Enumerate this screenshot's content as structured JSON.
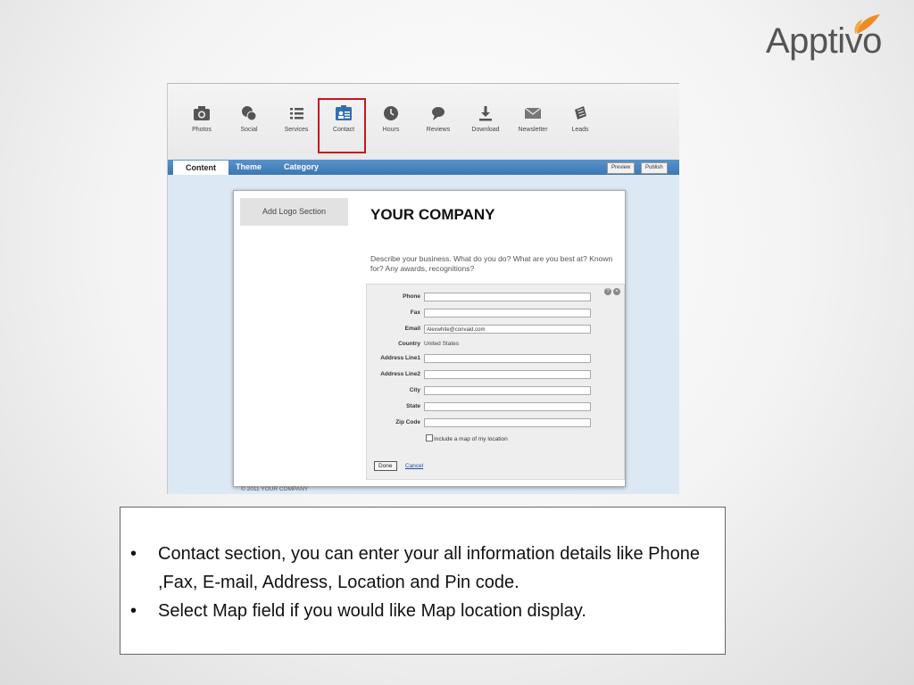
{
  "brand": {
    "name": "Apptivo"
  },
  "toolbar": {
    "items": [
      {
        "label": "Photos",
        "icon": "camera-icon"
      },
      {
        "label": "Social",
        "icon": "social-icon"
      },
      {
        "label": "Services",
        "icon": "list-icon"
      },
      {
        "label": "Contact",
        "icon": "contact-card-icon",
        "selected": true
      },
      {
        "label": "Hours",
        "icon": "clock-icon"
      },
      {
        "label": "Reviews",
        "icon": "speech-bubble-icon"
      },
      {
        "label": "Download",
        "icon": "download-icon"
      },
      {
        "label": "Newsletter",
        "icon": "envelope-icon"
      },
      {
        "label": "Leads",
        "icon": "leads-icon"
      }
    ]
  },
  "tabs": {
    "content": "Content",
    "theme": "Theme",
    "category": "Category",
    "preview": "Preview",
    "publish": "Publish"
  },
  "page": {
    "logo_section": "Add Logo Section",
    "company": "YOUR COMPANY",
    "description": "Describe your business. What do you do? What are you best at? Known for? Any awards, recognitions?",
    "copyright": "© 2011 YOUR COMPANY"
  },
  "contact_form": {
    "fields": {
      "phone": {
        "label": "Phone",
        "value": ""
      },
      "fax": {
        "label": "Fax",
        "value": ""
      },
      "email": {
        "label": "Email",
        "value": "Alexwhite@convaid.com"
      },
      "country": {
        "label": "Country",
        "value": "United States"
      },
      "address1": {
        "label": "Address Line1",
        "value": ""
      },
      "address2": {
        "label": "Address Line2",
        "value": ""
      },
      "city": {
        "label": "City",
        "value": ""
      },
      "state": {
        "label": "State",
        "value": ""
      },
      "zip": {
        "label": "Zip Code",
        "value": ""
      }
    },
    "map_checkbox": "Include a map of my location",
    "map_checked": false,
    "done": "Done",
    "cancel": "Cancel"
  },
  "caption": {
    "bullets": [
      "Contact section, you can enter your all information details like Phone ,Fax, E-mail, Address, Location and Pin code.",
      "Select Map field if you would like Map location display."
    ]
  },
  "colors": {
    "tab_bar": "#3a77b5",
    "selected_outline": "#c8161d",
    "brand_leaf": "#f08a24",
    "link": "#1a4fa3"
  }
}
